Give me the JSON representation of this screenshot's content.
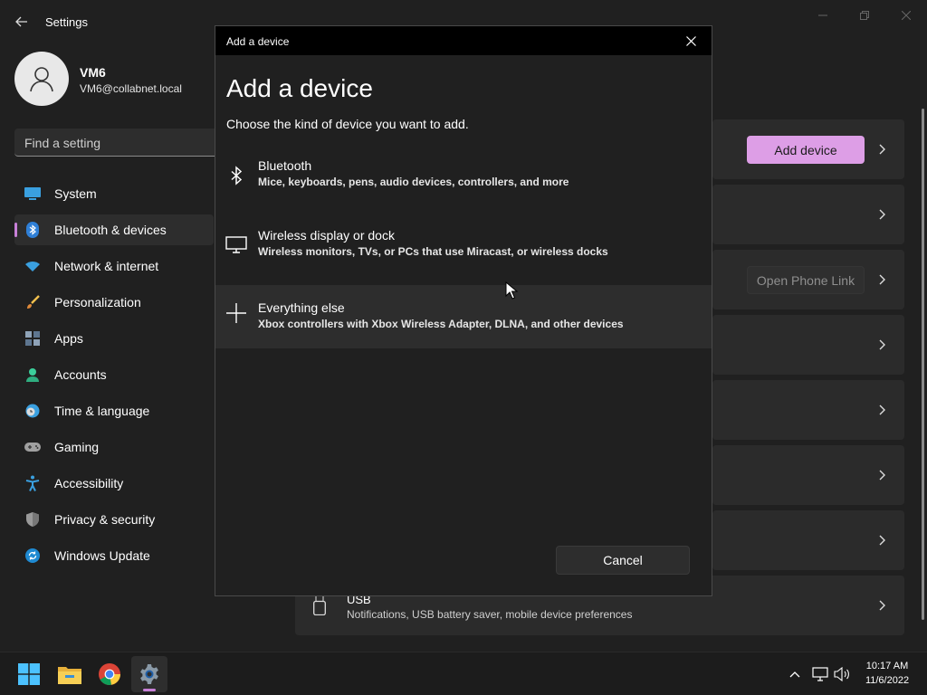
{
  "window": {
    "title": "Settings",
    "back_icon": "back-arrow-icon",
    "controls": [
      "minimize-icon",
      "maximize-icon",
      "close-icon"
    ]
  },
  "profile": {
    "name": "VM6",
    "email": "VM6@collabnet.local",
    "avatar_icon": "person-icon"
  },
  "search": {
    "placeholder": "Find a setting"
  },
  "sidebar": {
    "accent_color": "#c880d8",
    "items": [
      {
        "label": "System",
        "icon": "system-icon",
        "active": false
      },
      {
        "label": "Bluetooth & devices",
        "icon": "bluetooth-icon",
        "active": true
      },
      {
        "label": "Network & internet",
        "icon": "wifi-icon",
        "active": false
      },
      {
        "label": "Personalization",
        "icon": "brush-icon",
        "active": false
      },
      {
        "label": "Apps",
        "icon": "apps-icon",
        "active": false
      },
      {
        "label": "Accounts",
        "icon": "accounts-icon",
        "active": false
      },
      {
        "label": "Time & language",
        "icon": "clock-globe-icon",
        "active": false
      },
      {
        "label": "Gaming",
        "icon": "gamepad-icon",
        "active": false
      },
      {
        "label": "Accessibility",
        "icon": "accessibility-icon",
        "active": false
      },
      {
        "label": "Privacy & security",
        "icon": "shield-icon",
        "active": false
      },
      {
        "label": "Windows Update",
        "icon": "update-icon",
        "active": false
      }
    ]
  },
  "content": {
    "add_device_label": "Add device",
    "open_phone_link_label": "Open Phone Link",
    "usb": {
      "title": "USB",
      "subtitle": "Notifications, USB battery saver, mobile device preferences"
    }
  },
  "dialog": {
    "titlebar": "Add a device",
    "heading": "Add a device",
    "subtitle": "Choose the kind of device you want to add.",
    "options": [
      {
        "title": "Bluetooth",
        "description": "Mice, keyboards, pens, audio devices, controllers, and more",
        "icon": "bluetooth-icon"
      },
      {
        "title": "Wireless display or dock",
        "description": "Wireless monitors, TVs, or PCs that use Miracast, or wireless docks",
        "icon": "monitor-icon"
      },
      {
        "title": "Everything else",
        "description": "Xbox controllers with Xbox Wireless Adapter, DLNA, and other devices",
        "icon": "plus-icon"
      }
    ],
    "cancel_label": "Cancel"
  },
  "taskbar": {
    "apps": [
      "windows-start-icon",
      "file-explorer-icon",
      "chrome-icon",
      "settings-gear-icon"
    ],
    "tray": [
      "chevron-up-icon",
      "network-icon",
      "volume-icon"
    ],
    "time": "10:17 AM",
    "date": "11/6/2022"
  }
}
